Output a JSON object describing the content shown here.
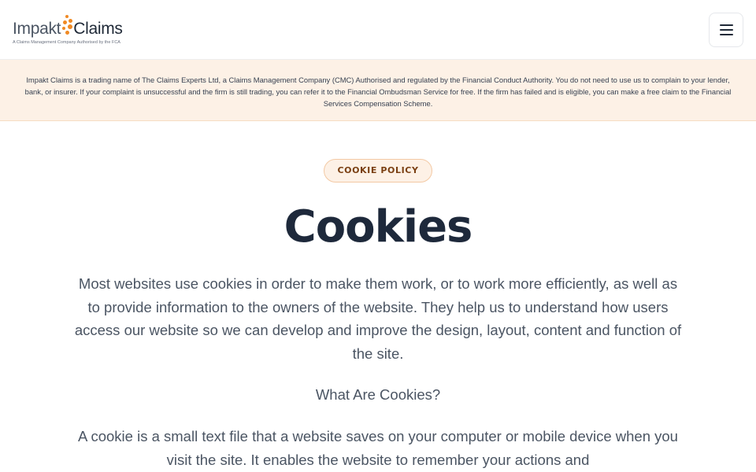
{
  "header": {
    "logo": {
      "word1": "Impakt",
      "word2": "Claims",
      "tagline": "A Claims Management Company Authorised by the FCA",
      "accent_color": "#f08a24"
    },
    "menu_icon": "hamburger-menu-icon"
  },
  "notice": {
    "text": "Impakt Claims is a trading name of The Claims Experts Ltd, a Claims Management Company (CMC) Authorised and regulated by the Financial Conduct Authority. You do not need to use us to complain to your lender, bank, or insurer. If your complaint is unsuccessful and the firm is still trading, you can refer it to the Financial Ombudsman Service for free. If the firm has failed and is eligible, you can make a free claim to the Financial Services Compensation Scheme."
  },
  "main": {
    "badge": "COOKIE POLICY",
    "title": "Cookies",
    "intro": "Most websites use cookies in order to make them work, or to work more efficiently, as well as to provide information to the owners of the website. They help us to understand how users access our website so we can develop and improve the design, layout, content and function of the site.",
    "subheading": "What Are Cookies?",
    "definition": "A cookie is a small text file that a website saves on your computer or mobile device when you visit the site. It enables the website to remember your actions and"
  }
}
